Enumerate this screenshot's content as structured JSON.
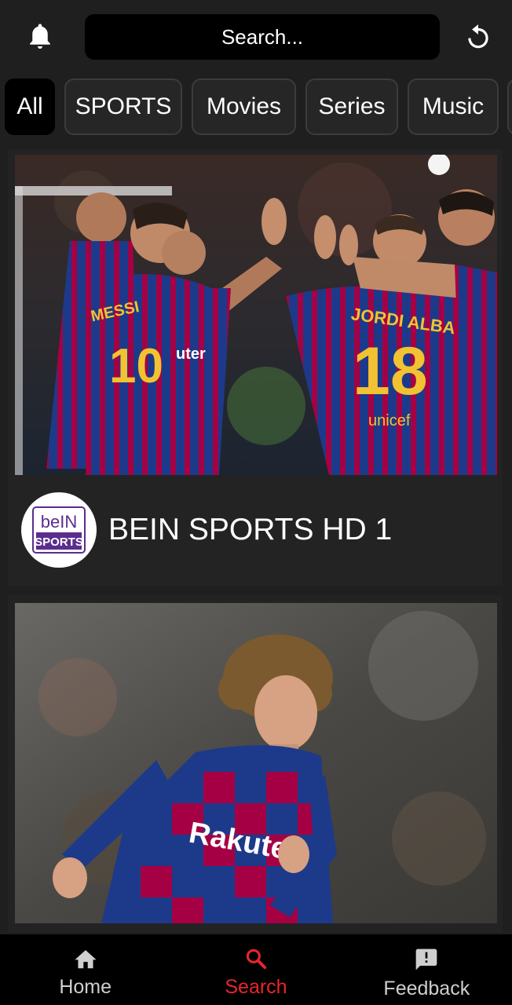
{
  "search": {
    "placeholder": "Search..."
  },
  "chips": [
    "All",
    "SPORTS",
    "Movies",
    "Series",
    "Music"
  ],
  "cards": [
    {
      "channel_name": "BEIN SPORTS HD 1",
      "logo_line1": "beIN",
      "logo_line2": "SPORTS",
      "jersey_text_1": "JORDI ALBA",
      "jersey_number_1": "18",
      "jersey_text_2": "MESSI",
      "jersey_number_2": "10",
      "sponsor_1": "unicef",
      "sponsor_2": "uter"
    },
    {
      "sponsor": "Rakuten"
    }
  ],
  "nav": {
    "home": "Home",
    "search": "Search",
    "feedback": "Feedback"
  },
  "colors": {
    "background": "#1f1f1f",
    "accent": "#e8262b",
    "barca_blue": "#1d3a8a",
    "barca_red": "#a50044",
    "bein_purple": "#5b2d8e"
  }
}
